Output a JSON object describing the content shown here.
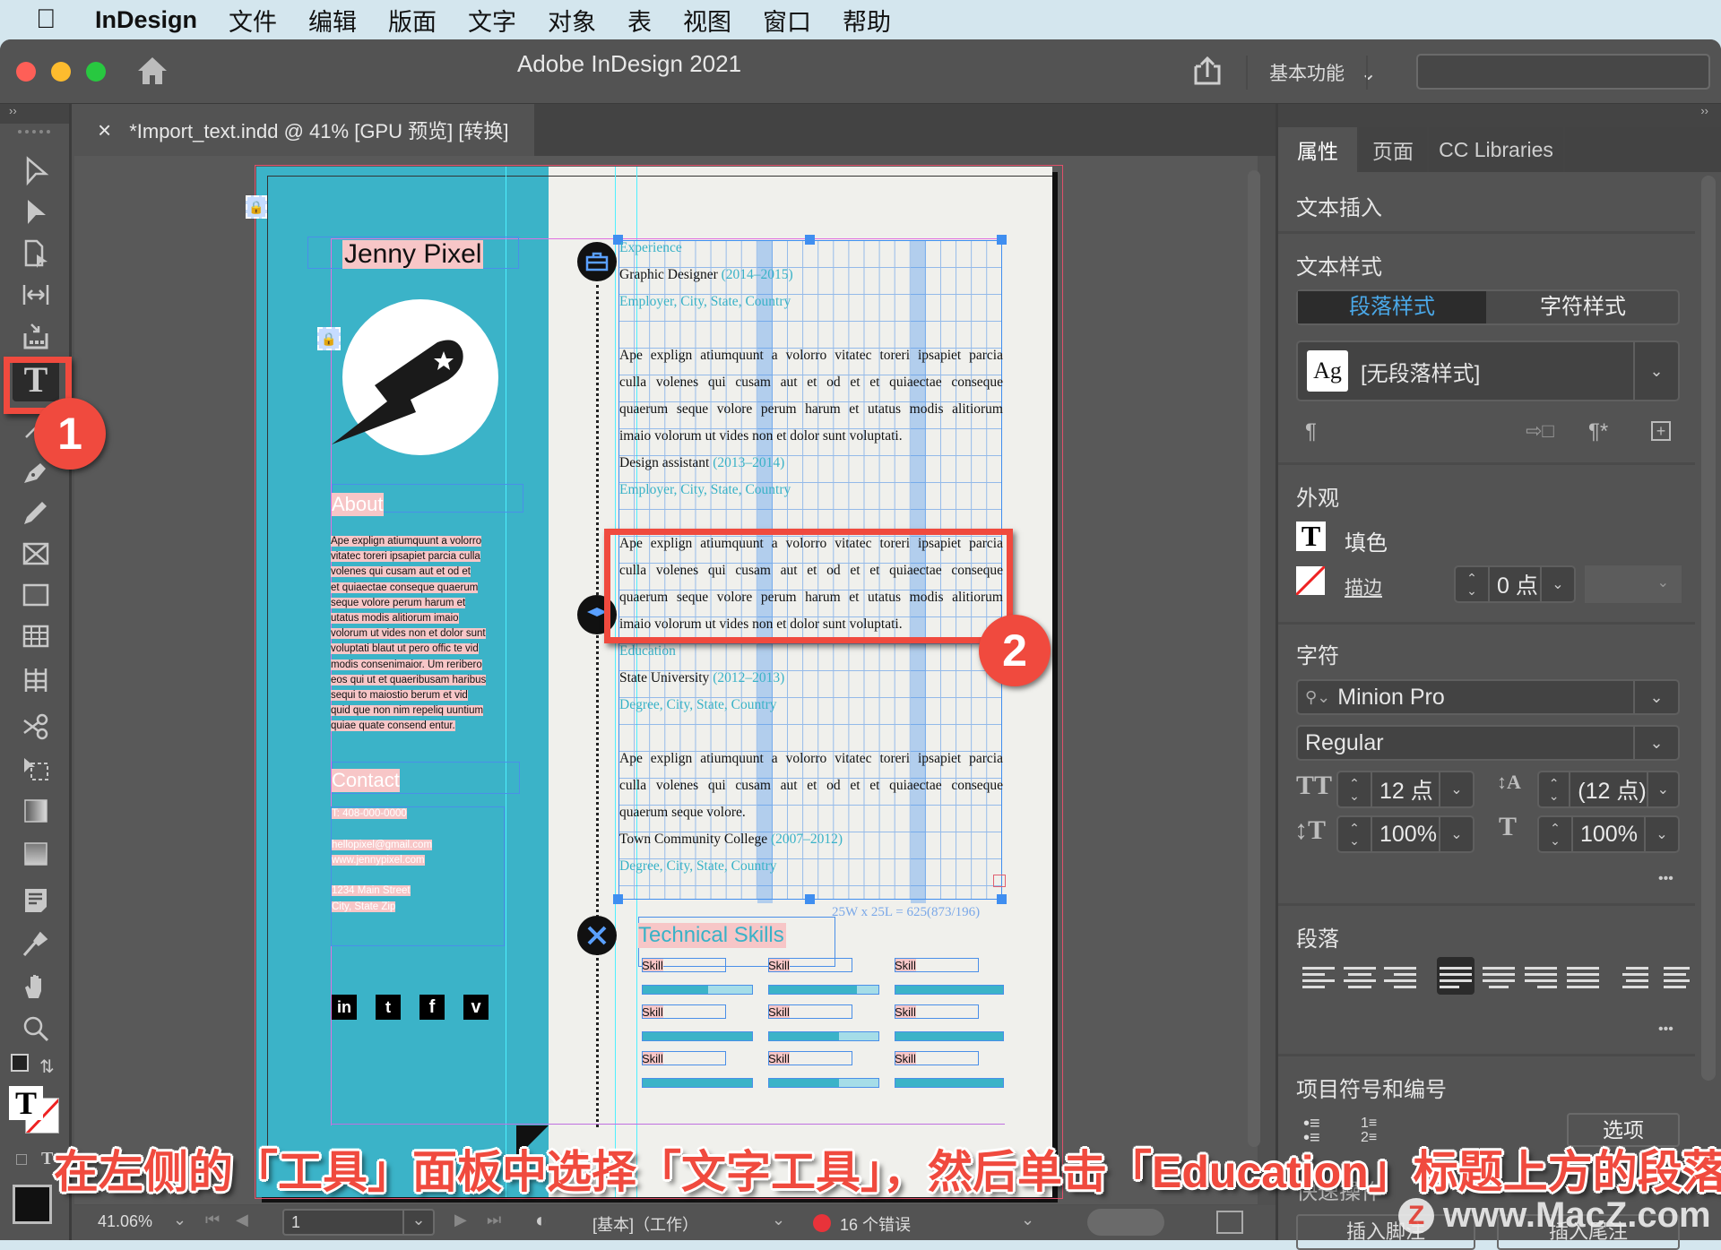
{
  "menubar": {
    "apple": "",
    "items": [
      "InDesign",
      "文件",
      "编辑",
      "版面",
      "文字",
      "对象",
      "表",
      "视图",
      "窗口",
      "帮助"
    ]
  },
  "window": {
    "title": "Adobe InDesign 2021",
    "workspace": "基本功能",
    "search_value": ""
  },
  "document_tab": {
    "close": "×",
    "label": "*Import_text.indd @ 41% [GPU 预览] [转换]"
  },
  "tools": [
    "selection-tool",
    "direct-selection-tool",
    "page-tool",
    "gap-tool",
    "content-collector-tool",
    "type-tool",
    "line-tool",
    "pen-tool",
    "pencil-tool",
    "rectangle-frame-tool",
    "rectangle-tool",
    "table-tool",
    "table-columns-tool",
    "scissors-tool",
    "free-transform-tool",
    "gradient-swatch-tool",
    "gradient-feather-tool",
    "note-tool",
    "eyedropper-tool",
    "hand-tool",
    "zoom-tool"
  ],
  "document": {
    "name": "Jenny Pixel",
    "about_heading": "About",
    "about_lines": [
      "Ape explign atiumquunt a volorro",
      "vitatec toreri ipsapiet parcia culla",
      "volenes qui cusam aut et od et",
      "et quiaectae conseque quaerum",
      "seque volore perum harum et",
      "utatus modis alitiorum imaio",
      "volorum ut vides non et dolor sunt",
      "voluptati blaut ut pero offic te vid",
      "modis consenimaior. Um reribero",
      "eos qui ut et quaeribusam haribus",
      "sequi to maiostio berum et vid",
      "quid que non nim repeliq uuntium",
      "quiae quate consend entur."
    ],
    "contact_heading": "Contact",
    "phone": "T: 408-000-0000",
    "email": "hellopixel@gmail.com",
    "website": "www.jennypixel.com",
    "address1": "1234 Main Street",
    "address2": "City, State Zip",
    "social": [
      "in",
      "t",
      "f",
      "v"
    ],
    "experience_heading": "Experience",
    "job1_title": "Graphic Designer",
    "job1_years": "(2014–2015)",
    "job1_employer": "Employer, City, State, Country",
    "job1_desc": [
      "Ape explign atiumquunt a volorro vitatec toreri ipsapiet parcia",
      "culla volenes qui cusam aut et od et et quiaectae conseque",
      "quaerum seque volore perum harum et utatus modis alitiorum",
      "imaio volorum ut vides non et dolor sunt voluptati."
    ],
    "job2_title": "Design assistant",
    "job2_years": "(2013–2014)",
    "job2_employer": "Employer, City, State, Country",
    "job2_desc": [
      "Ape explign atiumquunt a volorro vitatec toreri ipsapiet parcia",
      "culla volenes qui cusam aut et od et et quiaectae conseque",
      "quaerum seque volore perum harum et utatus modis alitiorum",
      "imaio volorum ut vides non et dolor sunt voluptati."
    ],
    "education_heading": "Education",
    "edu1_school": "State University",
    "edu1_years": "(2012–2013)",
    "edu1_degree": "Degree, City, State, Country",
    "edu1_desc": [
      "Ape explign atiumquunt a volorro vitatec toreri ipsapiet parcia",
      "culla volenes qui cusam aut et od et et quiaectae conseque",
      "quaerum seque volore."
    ],
    "edu2_school": "Town Community College",
    "edu2_years": "(2007–2012)",
    "edu2_degree": "Degree, City, State, Country",
    "table_info": "25W x 25L = 625(873/196)",
    "skills_heading": "Technical Skills",
    "skills": [
      {
        "label": "Skill",
        "level": 0.6
      },
      {
        "label": "Skill",
        "level": 0.8
      },
      {
        "label": "Skill",
        "level": 1.0
      },
      {
        "label": "Skill",
        "level": 1.0
      },
      {
        "label": "Skill",
        "level": 0.64
      },
      {
        "label": "Skill",
        "level": 1.0
      },
      {
        "label": "Skill",
        "level": 1.0
      },
      {
        "label": "Skill",
        "level": 0.64
      },
      {
        "label": "Skill",
        "level": 1.0
      }
    ]
  },
  "properties_panel": {
    "tabs": [
      "属性",
      "页面",
      "CC Libraries"
    ],
    "text_insert": "文本插入",
    "text_style": "文本样式",
    "style_tabs": [
      "段落样式",
      "字符样式"
    ],
    "para_style_value": "[无段落样式]",
    "ag": "Ag",
    "appearance": "外观",
    "fill_label": "填色",
    "stroke_label": "描边",
    "stroke_weight": "0 点",
    "character": "字符",
    "font_family": "Minion Pro",
    "font_style": "Regular",
    "font_size": "12 点",
    "leading": "(12 点)",
    "vertical_scale": "100%",
    "horizontal_scale": "100%",
    "paragraph": "段落",
    "bullets": "项目符号和编号",
    "options_button": "选项",
    "quick_actions": "快速操作",
    "insert_footnote": "插入脚注",
    "insert_endnote": "插入尾注",
    "more": "•••"
  },
  "statusbar": {
    "zoom": "41.06%",
    "page": "1",
    "preflight_profile": "[基本]（工作）",
    "errors": "16 个错误"
  },
  "callouts": {
    "step1": "1",
    "step2": "2",
    "caption": "在左侧的「工具」面板中选择「文字工具」，然后单击「Education」标题上方的段落",
    "watermark": "www.MacZ.com",
    "watermark_logo": "Z"
  },
  "colors": {
    "teal": "#3bb3c8",
    "accent_blue": "#4aa8e8",
    "callout_red": "#f04a3e",
    "error_red": "#e8333a"
  }
}
